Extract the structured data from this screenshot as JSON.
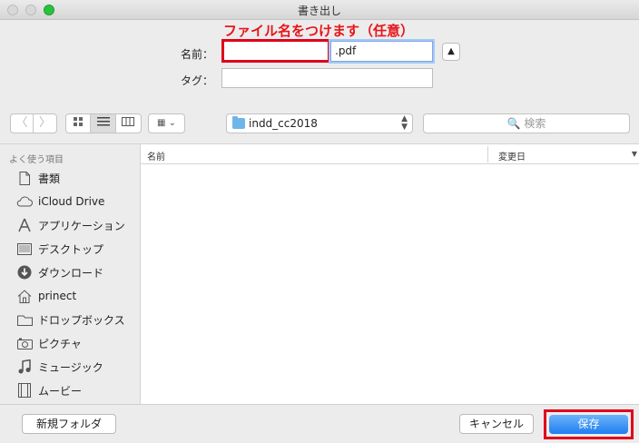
{
  "window": {
    "title": "書き出し"
  },
  "annotation": "ファイル名をつけます（任意）",
  "form": {
    "name_label": "名前：",
    "name_value": "",
    "extension": ".pdf",
    "tag_label": "タグ："
  },
  "toolbar": {
    "back_glyph": "〈",
    "forward_glyph": "〉",
    "current_folder": "indd_cc2018",
    "search_placeholder": "🔍 検索"
  },
  "sidebar": {
    "heading": "よく使う項目",
    "items": [
      {
        "label": "書類",
        "icon": "document-icon"
      },
      {
        "label": "iCloud Drive",
        "icon": "cloud-icon"
      },
      {
        "label": "アプリケーション",
        "icon": "applications-icon"
      },
      {
        "label": "デスクトップ",
        "icon": "desktop-icon"
      },
      {
        "label": "ダウンロード",
        "icon": "download-icon"
      },
      {
        "label": "prinect",
        "icon": "home-icon"
      },
      {
        "label": "ドロップボックス",
        "icon": "folder-icon"
      },
      {
        "label": "ピクチャ",
        "icon": "camera-icon"
      },
      {
        "label": "ミュージック",
        "icon": "music-icon"
      },
      {
        "label": "ムービー",
        "icon": "film-icon"
      }
    ]
  },
  "list": {
    "col_name": "名前",
    "col_date": "変更日"
  },
  "buttons": {
    "new_folder": "新規フォルダ",
    "cancel": "キャンセル",
    "save": "保存"
  }
}
